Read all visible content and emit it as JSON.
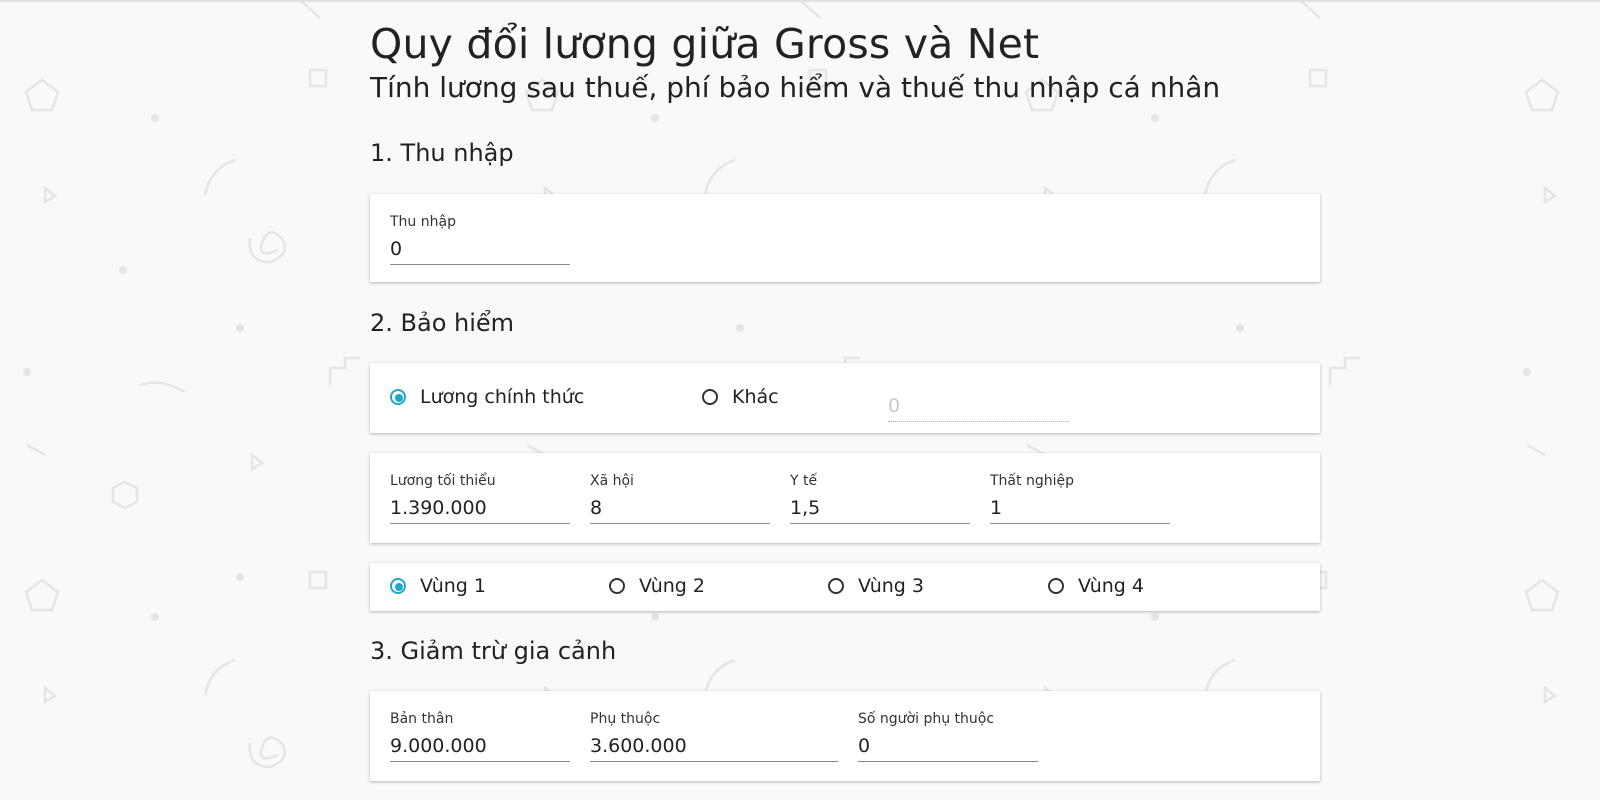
{
  "header": {
    "title": "Quy đổi lương giữa Gross và Net",
    "subtitle": "Tính lương sau thuế, phí bảo hiểm và thuế thu nhập cá nhân"
  },
  "income": {
    "heading": "1. Thu nhập",
    "field": {
      "label": "Thu nhập",
      "value": "0"
    }
  },
  "insurance": {
    "heading": "2. Bảo hiểm",
    "basis": {
      "options": [
        {
          "label": "Lương chính thức",
          "checked": true
        },
        {
          "label": "Khác",
          "checked": false
        }
      ],
      "other_placeholder": "0"
    },
    "rates": [
      {
        "label": "Lương tối thiểu",
        "value": "1.390.000"
      },
      {
        "label": "Xã hội",
        "value": "8"
      },
      {
        "label": "Y tế",
        "value": "1,5"
      },
      {
        "label": "Thất nghiệp",
        "value": "1"
      }
    ],
    "regions": {
      "options": [
        {
          "label": "Vùng 1",
          "checked": true
        },
        {
          "label": "Vùng 2",
          "checked": false
        },
        {
          "label": "Vùng 3",
          "checked": false
        },
        {
          "label": "Vùng 4",
          "checked": false
        }
      ]
    }
  },
  "deduction": {
    "heading": "3. Giảm trừ gia cảnh",
    "fields": [
      {
        "label": "Bản thân",
        "value": "9.000.000"
      },
      {
        "label": "Phụ thuộc",
        "value": "3.600.000"
      },
      {
        "label": "Số người phụ thuộc",
        "value": "0"
      }
    ]
  },
  "colors": {
    "accent": "#1ea7c9",
    "background": "#f8f9fa",
    "card": "#ffffff"
  }
}
